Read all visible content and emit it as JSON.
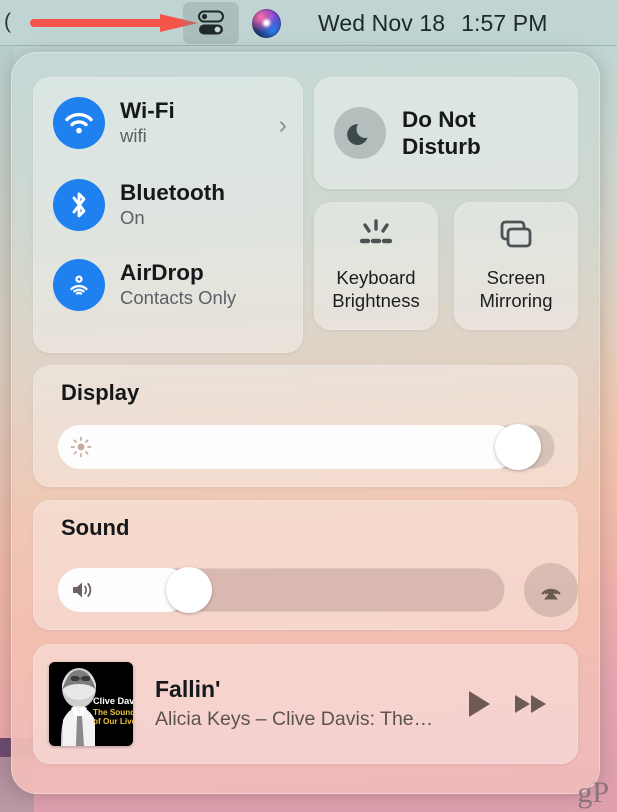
{
  "menubar": {
    "left_glyph": "(",
    "control_center_icon": "control-center-toggles-icon",
    "siri_icon": "siri-orb-icon",
    "date": "Wed Nov 18",
    "time": "1:57 PM",
    "annotation_arrow": "red-arrow-pointing-to-control-center"
  },
  "control_center": {
    "connectivity": [
      {
        "icon": "wifi-icon",
        "title": "Wi-Fi",
        "status": "wifi",
        "chevron": "›"
      },
      {
        "icon": "bluetooth-icon",
        "title": "Bluetooth",
        "status": "On"
      },
      {
        "icon": "airdrop-icon",
        "title": "AirDrop",
        "status": "Contacts Only"
      }
    ],
    "do_not_disturb": {
      "icon": "moon-icon",
      "label": "Do Not\nDisturb",
      "line1": "Do Not",
      "line2": "Disturb"
    },
    "tiles": [
      {
        "icon": "keyboard-brightness-icon",
        "line1": "Keyboard",
        "line2": "Brightness"
      },
      {
        "icon": "screen-mirroring-icon",
        "line1": "Screen",
        "line2": "Mirroring"
      }
    ],
    "display": {
      "title": "Display",
      "icon": "brightness-sun-icon",
      "value_percent": 97
    },
    "sound": {
      "title": "Sound",
      "icon": "speaker-volume-icon",
      "value_percent": 27,
      "airplay_icon": "airplay-audio-icon"
    },
    "now_playing": {
      "album_art_alt": "Clive Davis: The Soundtrack of Our Lives album cover",
      "album_art_line1": "Clive Davis",
      "album_art_line2": "The Soundtrack",
      "album_art_line3": "of Our Lives",
      "title": "Fallin'",
      "subtitle": "Alicia Keys – Clive Davis: The…",
      "play_icon": "play-icon",
      "next_icon": "fast-forward-icon"
    }
  },
  "watermark": {
    "text": "gP"
  },
  "colors": {
    "accent_blue": "#1f80f0",
    "arrow_red": "#f4554a",
    "menubar_bg": "#c0d5d3",
    "text_primary": "#15181a",
    "text_secondary": "#5b6166"
  }
}
